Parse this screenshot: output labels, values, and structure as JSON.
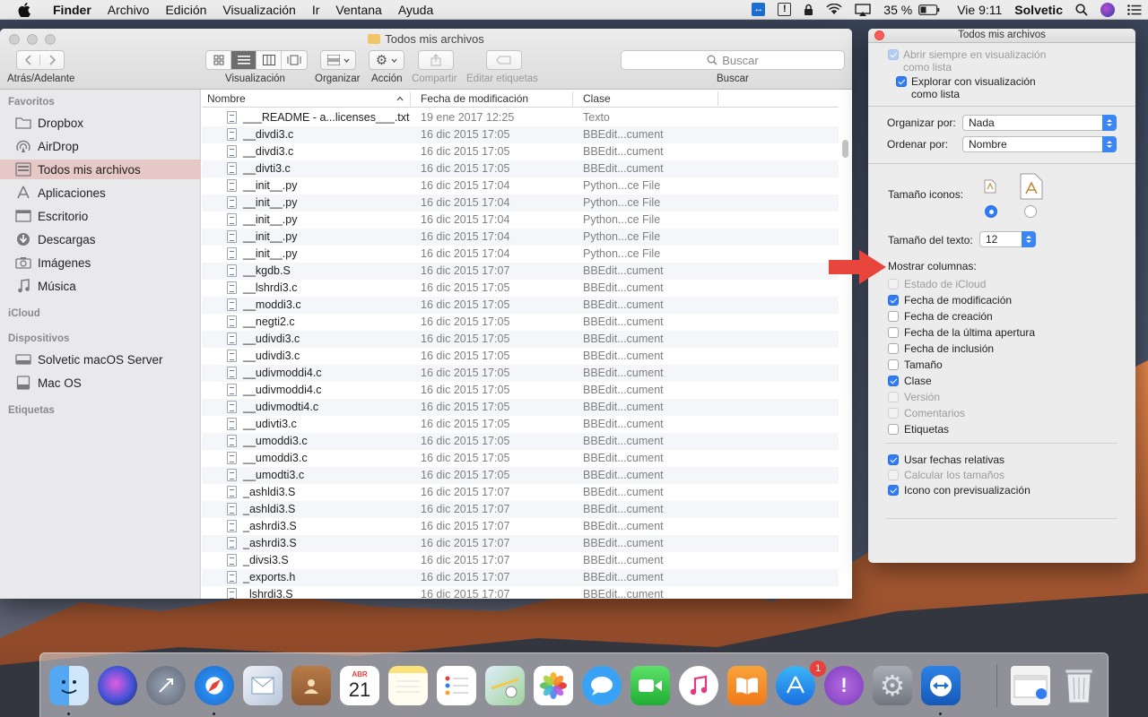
{
  "menubar": {
    "app": "Finder",
    "items": [
      "Archivo",
      "Edición",
      "Visualización",
      "Ir",
      "Ventana",
      "Ayuda"
    ],
    "battery": "35 %",
    "clock": "Vie 9:11",
    "user": "Solvetic"
  },
  "finder": {
    "title": "Todos mis archivos",
    "toolbar": {
      "back_forward_label": "Atrás/Adelante",
      "view_label": "Visualización",
      "arrange_label": "Organizar",
      "action_label": "Acción",
      "share_label": "Compartir",
      "tags_label": "Editar etiquetas",
      "search_label": "Buscar",
      "search_placeholder": "Buscar"
    },
    "sidebar": {
      "favorites_header": "Favoritos",
      "favorites": [
        {
          "label": "Dropbox",
          "icon": "folder-icon"
        },
        {
          "label": "AirDrop",
          "icon": "airdrop-icon"
        },
        {
          "label": "Todos mis archivos",
          "icon": "all-files-icon",
          "selected": true
        },
        {
          "label": "Aplicaciones",
          "icon": "applications-icon"
        },
        {
          "label": "Escritorio",
          "icon": "desktop-icon"
        },
        {
          "label": "Descargas",
          "icon": "downloads-icon"
        },
        {
          "label": "Imágenes",
          "icon": "camera-icon"
        },
        {
          "label": "Música",
          "icon": "music-note-icon"
        }
      ],
      "icloud_header": "iCloud",
      "devices_header": "Dispositivos",
      "devices": [
        {
          "label": "Solvetic macOS Server",
          "icon": "drive-icon"
        },
        {
          "label": "Mac OS",
          "icon": "disk-icon"
        }
      ],
      "tags_header": "Etiquetas"
    },
    "columns": {
      "name": "Nombre",
      "date": "Fecha de modificación",
      "kind": "Clase"
    },
    "files": [
      {
        "name": "___README - a...licenses___.txt",
        "date": "19 ene 2017 12:25",
        "kind": "Texto"
      },
      {
        "name": "__divdi3.c",
        "date": "16 dic 2015 17:05",
        "kind": "BBEdit...cument"
      },
      {
        "name": "__divdi3.c",
        "date": "16 dic 2015 17:05",
        "kind": "BBEdit...cument"
      },
      {
        "name": "__divti3.c",
        "date": "16 dic 2015 17:05",
        "kind": "BBEdit...cument"
      },
      {
        "name": "__init__.py",
        "date": "16 dic 2015 17:04",
        "kind": "Python...ce File"
      },
      {
        "name": "__init__.py",
        "date": "16 dic 2015 17:04",
        "kind": "Python...ce File"
      },
      {
        "name": "__init__.py",
        "date": "16 dic 2015 17:04",
        "kind": "Python...ce File"
      },
      {
        "name": "__init__.py",
        "date": "16 dic 2015 17:04",
        "kind": "Python...ce File"
      },
      {
        "name": "__init__.py",
        "date": "16 dic 2015 17:04",
        "kind": "Python...ce File"
      },
      {
        "name": "__kgdb.S",
        "date": "16 dic 2015 17:07",
        "kind": "BBEdit...cument"
      },
      {
        "name": "__lshrdi3.c",
        "date": "16 dic 2015 17:05",
        "kind": "BBEdit...cument"
      },
      {
        "name": "__moddi3.c",
        "date": "16 dic 2015 17:05",
        "kind": "BBEdit...cument"
      },
      {
        "name": "__negti2.c",
        "date": "16 dic 2015 17:05",
        "kind": "BBEdit...cument"
      },
      {
        "name": "__udivdi3.c",
        "date": "16 dic 2015 17:05",
        "kind": "BBEdit...cument"
      },
      {
        "name": "__udivdi3.c",
        "date": "16 dic 2015 17:05",
        "kind": "BBEdit...cument"
      },
      {
        "name": "__udivmoddi4.c",
        "date": "16 dic 2015 17:05",
        "kind": "BBEdit...cument"
      },
      {
        "name": "__udivmoddi4.c",
        "date": "16 dic 2015 17:05",
        "kind": "BBEdit...cument"
      },
      {
        "name": "__udivmodti4.c",
        "date": "16 dic 2015 17:05",
        "kind": "BBEdit...cument"
      },
      {
        "name": "__udivti3.c",
        "date": "16 dic 2015 17:05",
        "kind": "BBEdit...cument"
      },
      {
        "name": "__umoddi3.c",
        "date": "16 dic 2015 17:05",
        "kind": "BBEdit...cument"
      },
      {
        "name": "__umoddi3.c",
        "date": "16 dic 2015 17:05",
        "kind": "BBEdit...cument"
      },
      {
        "name": "__umodti3.c",
        "date": "16 dic 2015 17:05",
        "kind": "BBEdit...cument"
      },
      {
        "name": "_ashldi3.S",
        "date": "16 dic 2015 17:07",
        "kind": "BBEdit...cument"
      },
      {
        "name": "_ashldi3.S",
        "date": "16 dic 2015 17:07",
        "kind": "BBEdit...cument"
      },
      {
        "name": "_ashrdi3.S",
        "date": "16 dic 2015 17:07",
        "kind": "BBEdit...cument"
      },
      {
        "name": "_ashrdi3.S",
        "date": "16 dic 2015 17:07",
        "kind": "BBEdit...cument"
      },
      {
        "name": "_divsi3.S",
        "date": "16 dic 2015 17:07",
        "kind": "BBEdit...cument"
      },
      {
        "name": "_exports.h",
        "date": "16 dic 2015 17:07",
        "kind": "BBEdit...cument"
      },
      {
        "name": "_lshrdi3.S",
        "date": "16 dic 2015 17:07",
        "kind": "BBEdit...cument"
      }
    ]
  },
  "view_options": {
    "title": "Todos mis archivos",
    "always_open_list": "Abrir siempre en visualización como lista",
    "browse_list": "Explorar con visualización como lista",
    "arrange_by_label": "Organizar por:",
    "arrange_by_value": "Nada",
    "sort_by_label": "Ordenar por:",
    "sort_by_value": "Nombre",
    "icon_size_label": "Tamaño iconos:",
    "text_size_label": "Tamaño del texto:",
    "text_size_value": "12",
    "show_columns_label": "Mostrar columnas:",
    "columns": [
      {
        "label": "Estado de iCloud",
        "checked": false,
        "disabled": true
      },
      {
        "label": "Fecha de modificación",
        "checked": true,
        "disabled": false
      },
      {
        "label": "Fecha de creación",
        "checked": false,
        "disabled": false
      },
      {
        "label": "Fecha de la última apertura",
        "checked": false,
        "disabled": false
      },
      {
        "label": "Fecha de inclusión",
        "checked": false,
        "disabled": false
      },
      {
        "label": "Tamaño",
        "checked": false,
        "disabled": false
      },
      {
        "label": "Clase",
        "checked": true,
        "disabled": false
      },
      {
        "label": "Versión",
        "checked": false,
        "disabled": true
      },
      {
        "label": "Comentarios",
        "checked": false,
        "disabled": true
      },
      {
        "label": "Etiquetas",
        "checked": false,
        "disabled": false
      }
    ],
    "extras": [
      {
        "label": "Usar fechas relativas",
        "checked": true,
        "disabled": false
      },
      {
        "label": "Calcular los tamaños",
        "checked": false,
        "disabled": true
      },
      {
        "label": "Icono con previsualización",
        "checked": true,
        "disabled": false
      }
    ]
  },
  "dock": {
    "calendar_month": "ABR",
    "calendar_day": "21",
    "appstore_badge": "1"
  },
  "colors": {
    "accent": "#2f7cf6",
    "sidebar_selected": "#e6c8c6",
    "close_button": "#fc5b57",
    "annotation_arrow": "#e8453c"
  }
}
